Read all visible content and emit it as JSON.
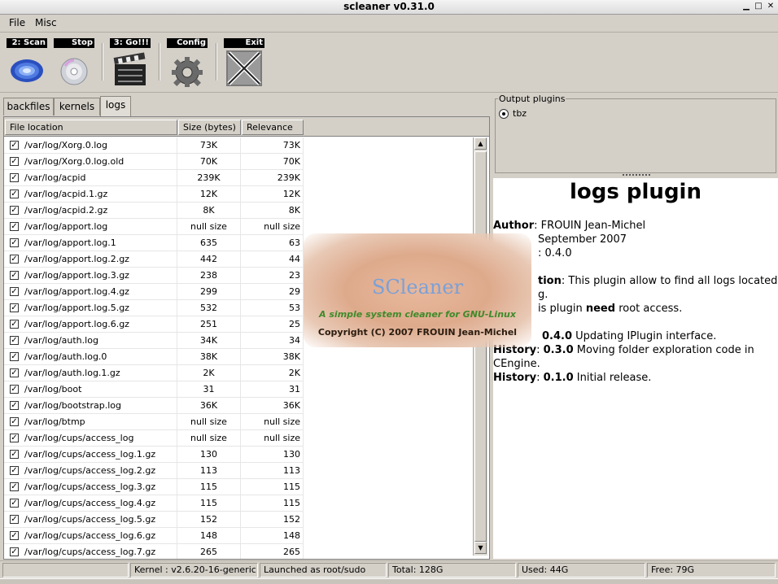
{
  "window": {
    "title": "scleaner v0.31.0"
  },
  "menu": {
    "file": "File",
    "misc": "Misc"
  },
  "toolbar": {
    "scan": "2: Scan",
    "stop": "Stop",
    "go": "3: Go!!!",
    "config": "Config",
    "exit": "Exit"
  },
  "tabs": [
    "backfiles",
    "kernels",
    "logs"
  ],
  "table": {
    "headers": [
      "File location",
      "Size (bytes)",
      "Relevance"
    ],
    "rows": [
      [
        "/var/log/Xorg.0.log",
        "73K",
        "73K"
      ],
      [
        "/var/log/Xorg.0.log.old",
        "70K",
        "70K"
      ],
      [
        "/var/log/acpid",
        "239K",
        "239K"
      ],
      [
        "/var/log/acpid.1.gz",
        "12K",
        "12K"
      ],
      [
        "/var/log/acpid.2.gz",
        "8K",
        "8K"
      ],
      [
        "/var/log/apport.log",
        "null size",
        "null size"
      ],
      [
        "/var/log/apport.log.1",
        "635",
        "63"
      ],
      [
        "/var/log/apport.log.2.gz",
        "442",
        "44"
      ],
      [
        "/var/log/apport.log.3.gz",
        "238",
        "23"
      ],
      [
        "/var/log/apport.log.4.gz",
        "299",
        "29"
      ],
      [
        "/var/log/apport.log.5.gz",
        "532",
        "53"
      ],
      [
        "/var/log/apport.log.6.gz",
        "251",
        "25"
      ],
      [
        "/var/log/auth.log",
        "34K",
        "34"
      ],
      [
        "/var/log/auth.log.0",
        "38K",
        "38K"
      ],
      [
        "/var/log/auth.log.1.gz",
        "2K",
        "2K"
      ],
      [
        "/var/log/boot",
        "31",
        "31"
      ],
      [
        "/var/log/bootstrap.log",
        "36K",
        "36K"
      ],
      [
        "/var/log/btmp",
        "null size",
        "null size"
      ],
      [
        "/var/log/cups/access_log",
        "null size",
        "null size"
      ],
      [
        "/var/log/cups/access_log.1.gz",
        "130",
        "130"
      ],
      [
        "/var/log/cups/access_log.2.gz",
        "113",
        "113"
      ],
      [
        "/var/log/cups/access_log.3.gz",
        "115",
        "115"
      ],
      [
        "/var/log/cups/access_log.4.gz",
        "115",
        "115"
      ],
      [
        "/var/log/cups/access_log.5.gz",
        "152",
        "152"
      ],
      [
        "/var/log/cups/access_log.6.gz",
        "148",
        "148"
      ],
      [
        "/var/log/cups/access_log.7.gz",
        "265",
        "265"
      ]
    ]
  },
  "output_plugins": {
    "legend": "Output plugins",
    "option": "tbz"
  },
  "info": {
    "title": "logs plugin",
    "author_key": "Author",
    "author_val": ": FROUIN Jean-Michel",
    "date_val": "September 2007",
    "version_val": ": 0.4.0",
    "desc_key": "tion",
    "desc_val": ": This plugin allow to find all logs located",
    "desc_cont": "g.",
    "need_pre": "is plugin ",
    "need_key": "need",
    "need_post": " root access.",
    "h1_ver": "0.4.0",
    "h1_text": " Updating IPlugin interface.",
    "h2_key": "History",
    "h2_ver": "0.3.0",
    "h2_text": " Moving folder exploration code in",
    "h2_cont": "CEngine.",
    "h3_key": "History",
    "h3_ver": "0.1.0",
    "h3_text": " Initial release."
  },
  "splash": {
    "brand": "SCleaner",
    "tagline": "A simple system cleaner for GNU-Linux",
    "copyright": "Copyright (C) 2007 FROUIN Jean-Michel"
  },
  "status": {
    "kernel": "Kernel : v2.6.20-16-generic",
    "launched": "Launched as root/sudo",
    "total": "Total: 128G",
    "used": "Used: 44G",
    "free": "Free: 79G"
  }
}
